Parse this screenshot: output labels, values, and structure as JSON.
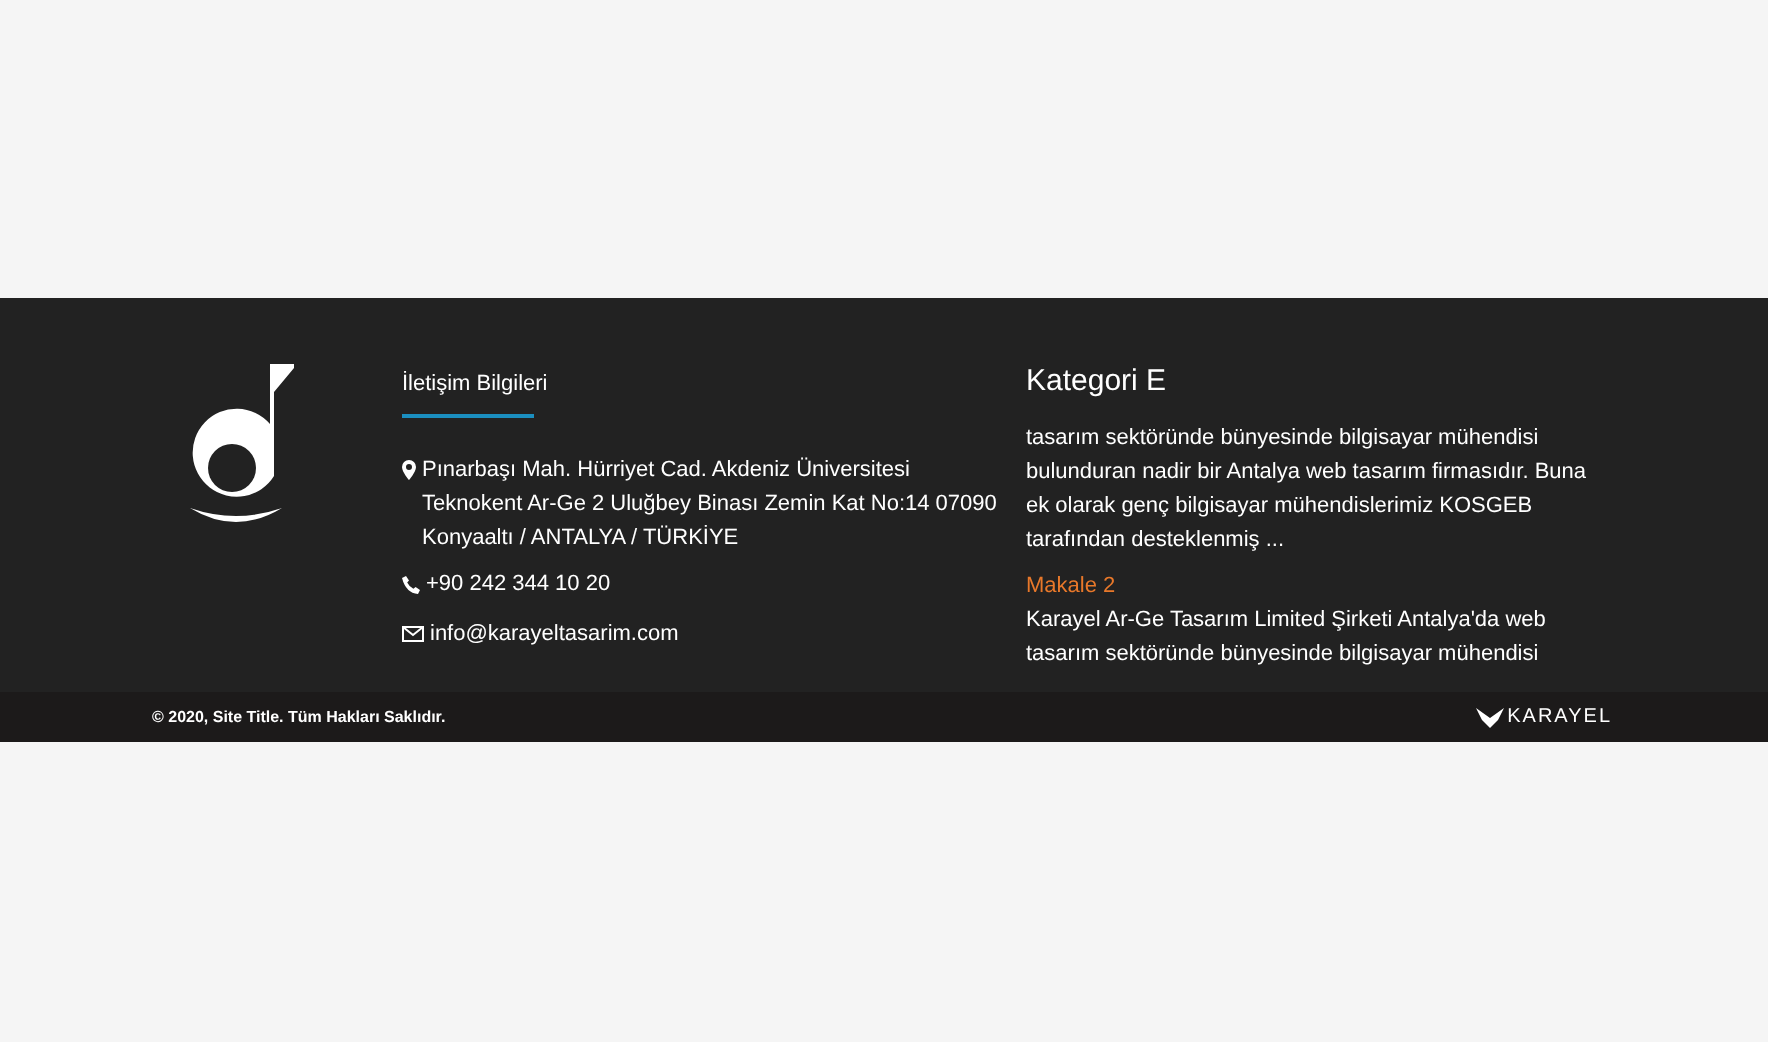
{
  "contact": {
    "heading": "İletişim Bilgileri",
    "address": [
      "Pınarbaşı Mah. Hürriyet Cad. Akdeniz Üniversitesi",
      "Teknokent Ar-Ge 2 Uluğbey Binası Zemin Kat No:14 07090",
      "Konyaaltı / ANTALYA / TÜRKİYE"
    ],
    "phone": "+90 242 344 10 20",
    "email": "info@karayeltasarim.com"
  },
  "category": {
    "title": "Kategori E",
    "items": [
      {
        "kind": "text",
        "text": "tasarım sektöründe bünyesinde bilgisayar mühendisi bulunduran nadir bir Antalya web tasarım firmasıdır. Buna ek olarak genç bilgisayar mühendislerimiz KOSGEB tarafından desteklenmiş ..."
      },
      {
        "kind": "title",
        "text": "Makale 2"
      },
      {
        "kind": "text",
        "text": "Karayel Ar-Ge Tasarım Limited Şirketi Antalya'da web tasarım sektöründe bünyesinde bilgisayar mühendisi"
      }
    ]
  },
  "bottom_bar": {
    "copyright": "© 2020, Site Title. Tüm Hakları Saklıdır.",
    "brand": "KARAYEL"
  }
}
